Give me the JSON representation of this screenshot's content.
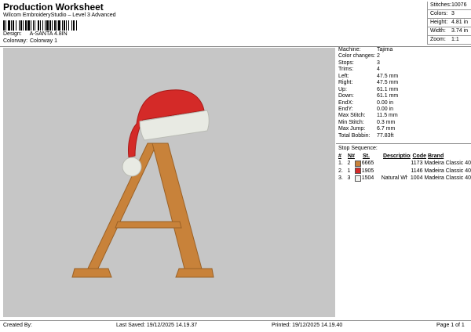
{
  "header": {
    "title": "Production Worksheet",
    "subtitle": "Wilcom EmbroideryStudio – Level 3 Advanced"
  },
  "meta": {
    "design_label": "Design:",
    "design_value": "A-SANTA 4.8IN",
    "colorway_label": "Colorway:",
    "colorway_value": "Colorway 1"
  },
  "stats": [
    {
      "label": "Stitches:",
      "value": "10076"
    },
    {
      "label": "Colors:",
      "value": "3"
    },
    {
      "label": "Height:",
      "value": "4.81 in"
    },
    {
      "label": "Width:",
      "value": "3.74 in"
    },
    {
      "label": "Zoom:",
      "value": "1:1"
    }
  ],
  "details": [
    {
      "label": "Machine:",
      "value": "Tajima"
    },
    {
      "label": "Color changes:",
      "value": "2"
    },
    {
      "label": "Stops:",
      "value": "3"
    },
    {
      "label": "Trims:",
      "value": "4"
    },
    {
      "label": "Left:",
      "value": "47.5 mm"
    },
    {
      "label": "Right:",
      "value": "47.5 mm"
    },
    {
      "label": "Up:",
      "value": "61.1 mm"
    },
    {
      "label": "Down:",
      "value": "61.1 mm"
    },
    {
      "label": "EndX:",
      "value": "0.00 in"
    },
    {
      "label": "EndY:",
      "value": "0.00 in"
    },
    {
      "label": "Max Stitch:",
      "value": "11.5 mm"
    },
    {
      "label": "Min Stitch:",
      "value": "0.3 mm"
    },
    {
      "label": "Max Jump:",
      "value": "6.7 mm"
    },
    {
      "label": "Total Bobbin:",
      "value": "77.83ft"
    }
  ],
  "sequence": {
    "title": "Stop Sequence:",
    "headers": {
      "num": "#",
      "n": "N#",
      "st": "St.",
      "desc": "Description",
      "code": "Code",
      "brand": "Brand"
    },
    "rows": [
      {
        "num": "1.",
        "n": "2",
        "st": "6665",
        "desc": "",
        "code": "1173",
        "brand": "Madeira Classic 40",
        "color": "#c8823a"
      },
      {
        "num": "2.",
        "n": "1",
        "st": "1905",
        "desc": "",
        "code": "1146",
        "brand": "Madeira Classic 40",
        "color": "#d42a28"
      },
      {
        "num": "3.",
        "n": "3",
        "st": "1504",
        "desc": "Natural White",
        "code": "1004",
        "brand": "Madeira Classic 40",
        "color": "#f2f2ee"
      }
    ]
  },
  "footer": {
    "created": "Created By:",
    "last_saved": "Last Saved: 19/12/2025 14.19.37",
    "printed": "Printed: 19/12/2025 14.19.40",
    "page": "Page 1 of 1"
  },
  "colors": {
    "letter": "#c8823a",
    "hat": "#d42a28",
    "trim": "#e8eae3",
    "background": "#c6c6c6"
  }
}
